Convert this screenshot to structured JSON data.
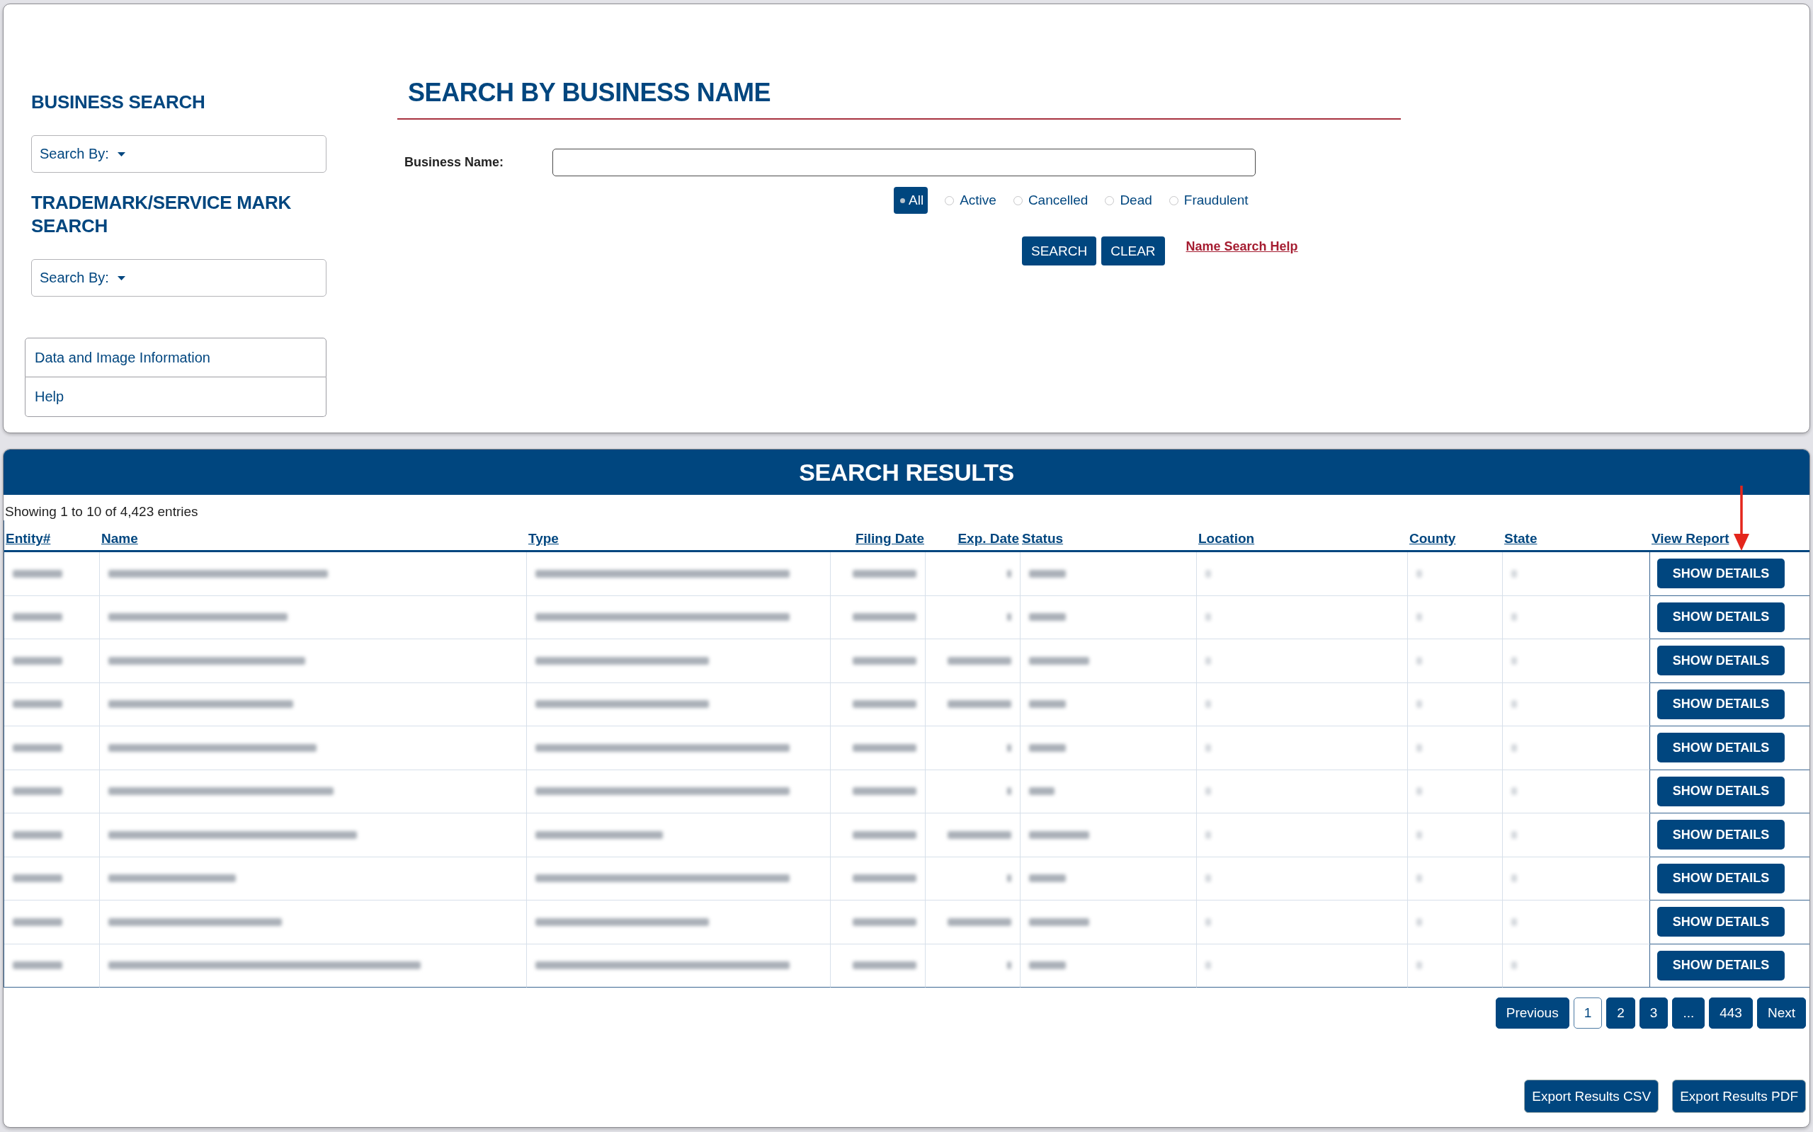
{
  "sidebar": {
    "sections": [
      {
        "heading": "BUSINESS SEARCH",
        "dropdown": "Search By:"
      },
      {
        "heading": "TRADEMARK/SERVICE MARK SEARCH",
        "dropdown": "Search By:"
      }
    ],
    "links": [
      "Data and Image Information",
      "Help"
    ]
  },
  "search_form": {
    "title": "SEARCH BY BUSINESS NAME",
    "field": {
      "label": "Business Name:"
    },
    "status_filters": [
      {
        "label": "All",
        "selected": true
      },
      {
        "label": "Active",
        "selected": false
      },
      {
        "label": "Cancelled",
        "selected": false
      },
      {
        "label": "Dead",
        "selected": false
      },
      {
        "label": "Fraudulent",
        "selected": false
      }
    ],
    "buttons": [
      "SEARCH",
      "CLEAR"
    ],
    "help_link": "Name Search Help"
  },
  "results": {
    "title": "SEARCH RESULTS",
    "summary": "Showing 1 to 10 of 4,423 entries",
    "columns": [
      "Entity#",
      "Name",
      "Type",
      "Filing Date",
      "Exp. Date",
      "Status",
      "Location",
      "County",
      "State",
      "View Report"
    ],
    "rows": [
      {
        "action": "SHOW DETAILS"
      },
      {
        "action": "SHOW DETAILS"
      },
      {
        "action": "SHOW DETAILS"
      },
      {
        "action": "SHOW DETAILS"
      },
      {
        "action": "SHOW DETAILS"
      },
      {
        "action": "SHOW DETAILS"
      },
      {
        "action": "SHOW DETAILS"
      },
      {
        "action": "SHOW DETAILS"
      },
      {
        "action": "SHOW DETAILS"
      },
      {
        "action": "SHOW DETAILS"
      }
    ],
    "pagination": [
      {
        "label": "Previous",
        "selected": false
      },
      {
        "label": "1",
        "selected": true
      },
      {
        "label": "2",
        "selected": false
      },
      {
        "label": "3",
        "selected": false
      },
      {
        "label": "...",
        "selected": false
      },
      {
        "label": "443",
        "selected": false
      },
      {
        "label": "Next",
        "selected": false
      }
    ],
    "export_buttons": [
      "Export Results CSV",
      "Export Results PDF"
    ]
  }
}
